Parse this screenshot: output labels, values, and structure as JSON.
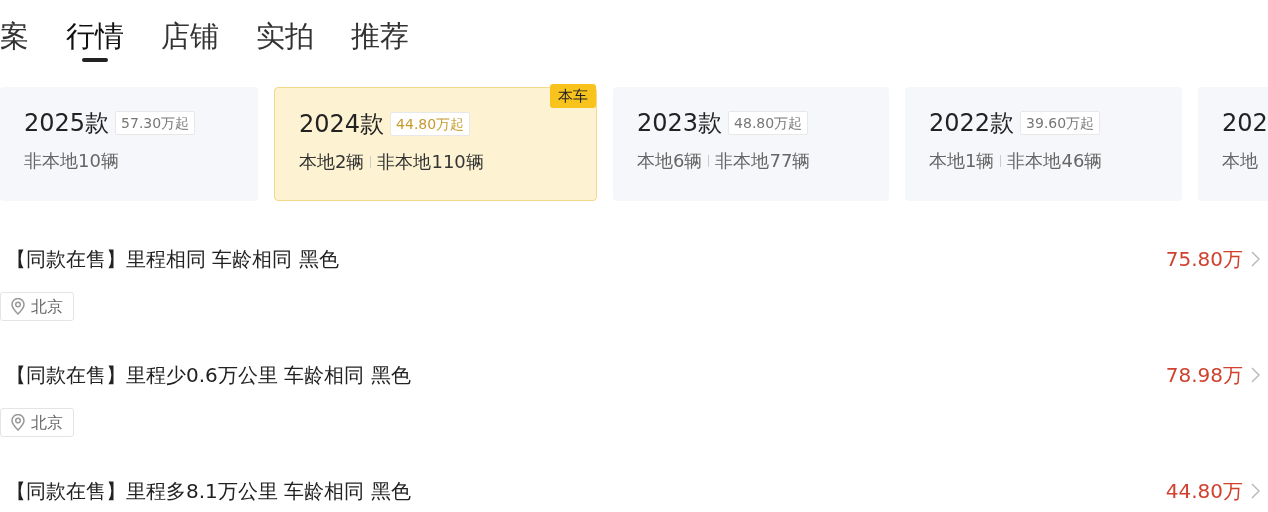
{
  "tabs": [
    {
      "label": "案",
      "selected": false
    },
    {
      "label": "行情",
      "selected": true
    },
    {
      "label": "店铺",
      "selected": false
    },
    {
      "label": "实拍",
      "selected": false
    },
    {
      "label": "推荐",
      "selected": false
    }
  ],
  "model_years": [
    {
      "year": "2025款",
      "price": "57.30万起",
      "nonlocal": "非本地10辆",
      "selected": false
    },
    {
      "year": "2024款",
      "price": "44.80万起",
      "local": "本地2辆",
      "nonlocal": "非本地110辆",
      "selected": true,
      "badge": "本车"
    },
    {
      "year": "2023款",
      "price": "48.80万起",
      "local": "本地6辆",
      "nonlocal": "非本地77辆",
      "selected": false
    },
    {
      "year": "2022款",
      "price": "39.60万起",
      "local": "本地1辆",
      "nonlocal": "非本地46辆",
      "selected": false
    },
    {
      "year": "202",
      "local": "本地",
      "selected": false
    }
  ],
  "listings": [
    {
      "title": "【同款在售】里程相同 车龄相同 黑色",
      "location": "北京",
      "price": "75.80万"
    },
    {
      "title": "【同款在售】里程少0.6万公里 车龄相同 黑色",
      "location": "北京",
      "price": "78.98万"
    },
    {
      "title": "【同款在售】里程多8.1万公里 车龄相同 黑色",
      "price": "44.80万"
    }
  ]
}
